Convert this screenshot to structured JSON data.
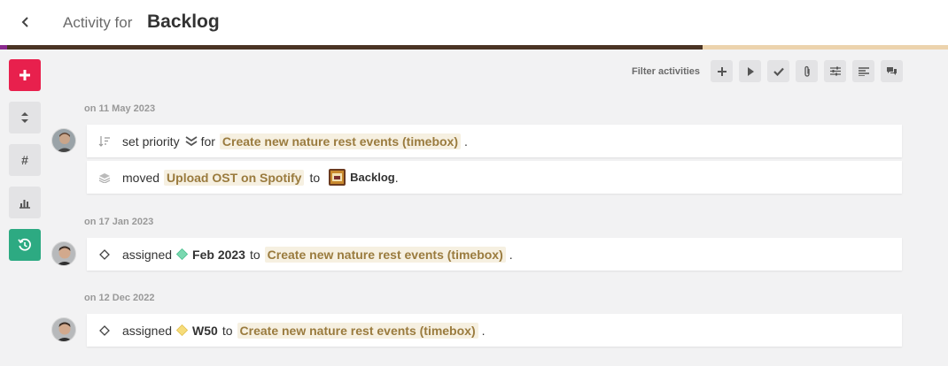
{
  "header": {
    "prefix": "Activity for",
    "title": "Backlog",
    "back_icon": "chevron-left-icon"
  },
  "colors": {
    "accent_add": "#e8204d",
    "accent_history": "#2daa82",
    "link_text": "#9a7b3e",
    "link_bg": "#f6f0e1",
    "stripe": [
      "#8a2a8e",
      "#4a3424",
      "#ecd3ad"
    ]
  },
  "sidebar": {
    "items": [
      {
        "name": "add",
        "icon": "plus-icon"
      },
      {
        "name": "sort",
        "icon": "sort-icon"
      },
      {
        "name": "hash",
        "icon": "hash-icon",
        "label": "#"
      },
      {
        "name": "stats",
        "icon": "bar-chart-icon"
      },
      {
        "name": "history",
        "icon": "history-icon"
      }
    ]
  },
  "filter": {
    "label": "Filter activities",
    "buttons": [
      "plus-icon",
      "play-icon",
      "check-icon",
      "paperclip-icon",
      "sliders-icon",
      "align-left-icon",
      "comments-icon"
    ]
  },
  "groups": [
    {
      "date": "on 11 May 2023",
      "entries": [
        {
          "icon": "sort-priority-icon",
          "action": "set priority",
          "priority_icon": "chevrons-down-icon",
          "connector": "for",
          "link": "Create new nature rest events (timebox)",
          "end": "."
        },
        {
          "icon": "layers-icon",
          "action": "moved",
          "link": "Upload OST on Spotify",
          "connector": "to",
          "target": "Backlog",
          "target_icon": "deck-image-icon",
          "end": "."
        }
      ]
    },
    {
      "date": "on 17 Jan 2023",
      "entries": [
        {
          "icon": "diamond-icon",
          "action": "assigned",
          "milestone_icon": "green-diamond-icon",
          "milestone": "Feb 2023",
          "connector": "to",
          "link": "Create new nature rest events (timebox)",
          "end": "."
        }
      ]
    },
    {
      "date": "on 12 Dec 2022",
      "entries": [
        {
          "icon": "diamond-icon",
          "action": "assigned",
          "milestone_icon": "yellow-diamond-icon",
          "milestone": "W50",
          "connector": "to",
          "link": "Create new nature rest events (timebox)",
          "end": "."
        }
      ]
    }
  ]
}
